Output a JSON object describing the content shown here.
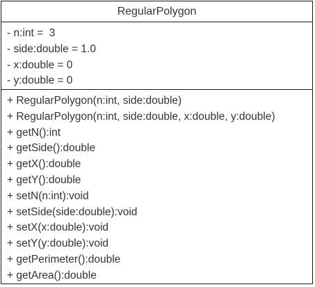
{
  "class_name": "RegularPolygon",
  "attributes": [
    "- n:int =  3",
    "- side:double = 1.0",
    "- x:double = 0",
    "- y:double = 0"
  ],
  "methods": [
    "+ RegularPolygon(n:int, side:double)",
    "+ RegularPolygon(n:int, side:double, x:double, y:double)",
    "+ getN():int",
    "+ getSide():double",
    "+ getX():double",
    "+ getY():double",
    "+ setN(n:int):void",
    "+ setSide(side:double):void",
    "+ setX(x:double):void",
    "+ setY(y:double):void",
    "+ getPerimeter():double",
    "+ getArea():double"
  ]
}
